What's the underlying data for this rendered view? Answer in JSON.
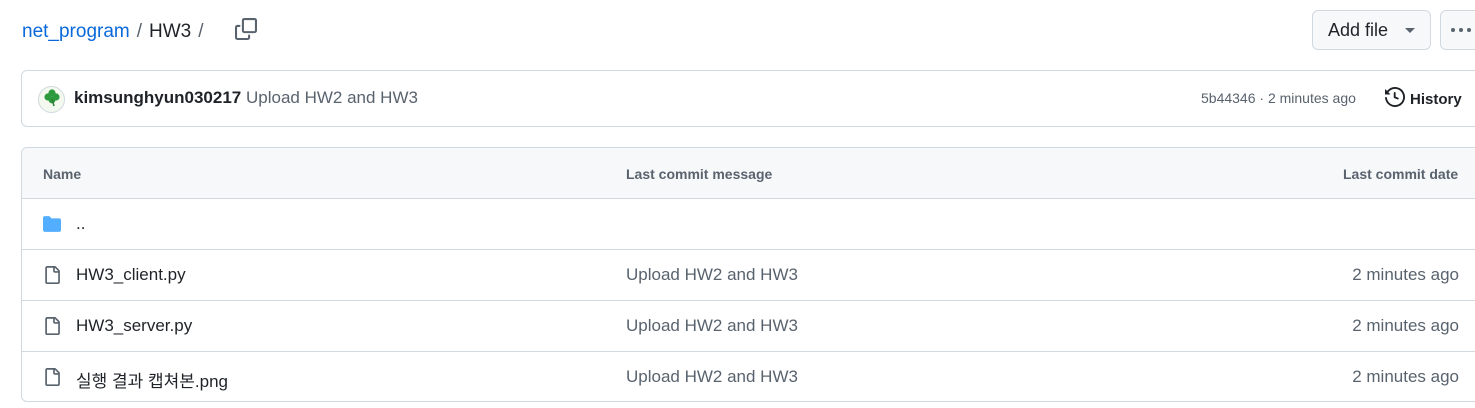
{
  "breadcrumb": {
    "repo": "net_program",
    "separator": "/",
    "folder": "HW3",
    "trailing_separator": "/"
  },
  "actions": {
    "add_file_label": "Add file",
    "more_icon": "kebab-horizontal-icon",
    "copy_icon": "copy-icon"
  },
  "commit": {
    "avatar_icon": "clover-avatar-icon",
    "author": "kimsunghyun030217",
    "message": "Upload HW2 and HW3",
    "meta": "5b44346 · 2 minutes ago",
    "history_label": "History",
    "history_icon": "history-icon"
  },
  "table": {
    "headers": {
      "name": "Name",
      "message": "Last commit message",
      "date": "Last commit date"
    },
    "rows": [
      {
        "type": "folder",
        "icon": "folder-icon",
        "name": "..",
        "message": "",
        "date": ""
      },
      {
        "type": "file",
        "icon": "file-icon",
        "name": "HW3_client.py",
        "message": "Upload HW2 and HW3",
        "date": "2 minutes ago"
      },
      {
        "type": "file",
        "icon": "file-icon",
        "name": "HW3_server.py",
        "message": "Upload HW2 and HW3",
        "date": "2 minutes ago"
      },
      {
        "type": "file",
        "icon": "file-icon",
        "name": "실행 결과 캡쳐본.png",
        "message": "Upload HW2 and HW3",
        "date": "2 minutes ago"
      }
    ]
  },
  "colors": {
    "link": "#0969da",
    "muted": "#59636e",
    "folder": "#54aeff",
    "border": "#d1d9e0",
    "header_bg": "#f6f8fa"
  }
}
